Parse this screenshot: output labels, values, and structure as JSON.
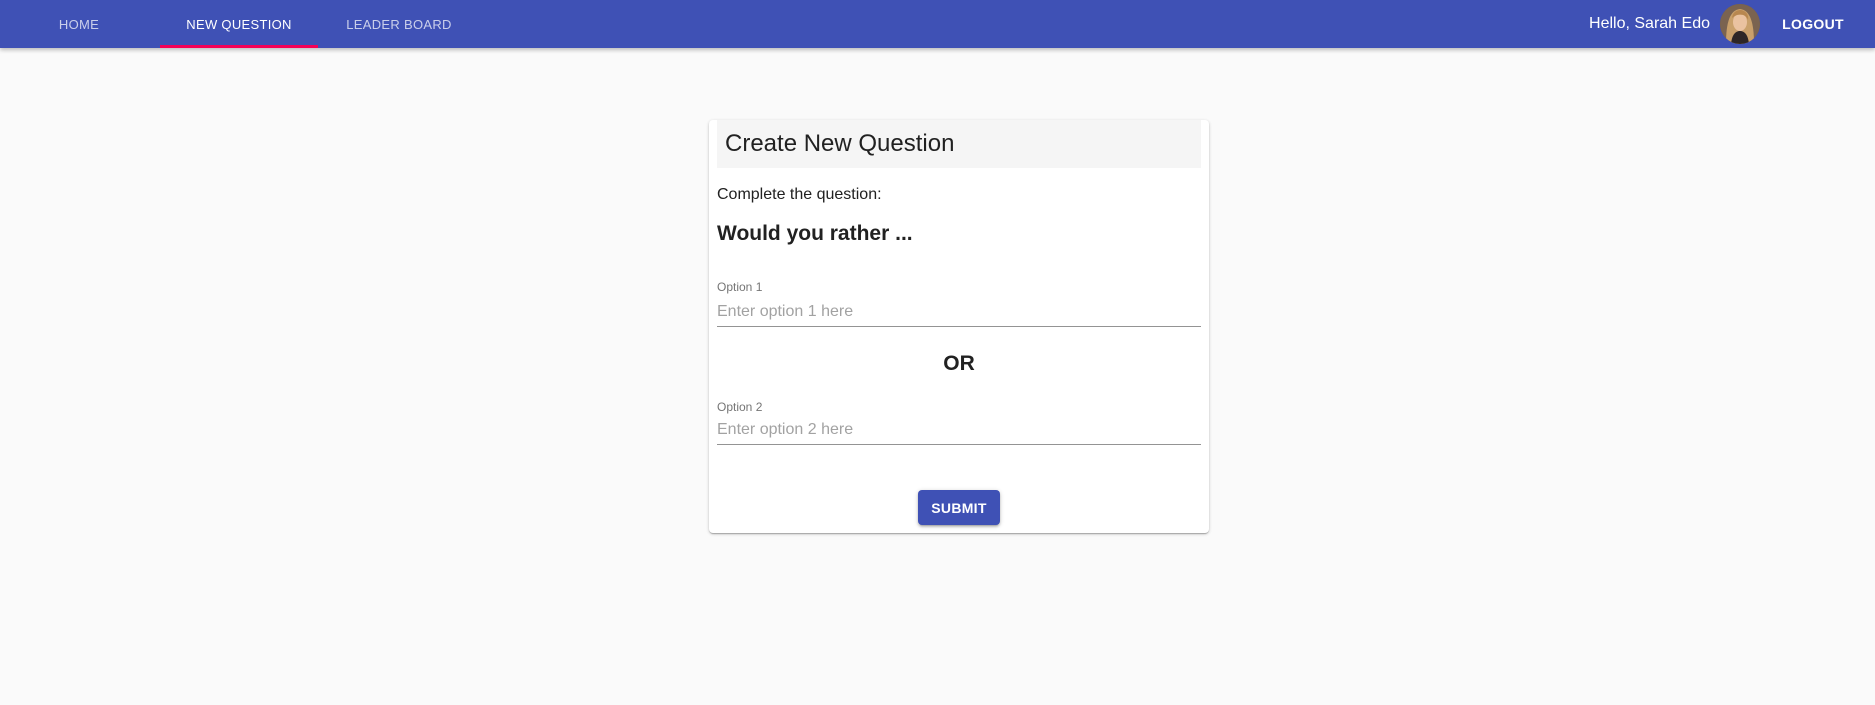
{
  "nav": {
    "tabs": [
      {
        "label": "HOME",
        "active": false
      },
      {
        "label": "NEW QUESTION",
        "active": true
      },
      {
        "label": "LEADER BOARD",
        "active": false
      }
    ],
    "greeting": "Hello, Sarah Edo",
    "logout_label": "LOGOUT"
  },
  "form": {
    "title": "Create New Question",
    "subtitle": "Complete the question:",
    "heading": "Would you rather ...",
    "option1": {
      "label": "Option 1",
      "placeholder": "Enter option 1 here",
      "value": ""
    },
    "separator": "OR",
    "option2": {
      "label": "Option 2",
      "placeholder": "Enter option 2 here",
      "value": ""
    },
    "submit_label": "SUBMIT"
  },
  "colors": {
    "primary": "#3f51b5",
    "tab_indicator": "#f50057",
    "background": "#fafafa"
  }
}
